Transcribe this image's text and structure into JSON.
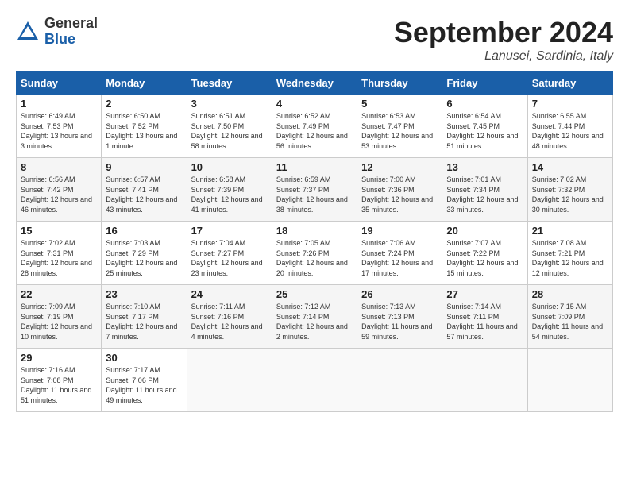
{
  "header": {
    "logo_general": "General",
    "logo_blue": "Blue",
    "month_title": "September 2024",
    "location": "Lanusei, Sardinia, Italy"
  },
  "weekdays": [
    "Sunday",
    "Monday",
    "Tuesday",
    "Wednesday",
    "Thursday",
    "Friday",
    "Saturday"
  ],
  "weeks": [
    [
      {
        "day": "1",
        "detail": "Sunrise: 6:49 AM\nSunset: 7:53 PM\nDaylight: 13 hours\nand 3 minutes."
      },
      {
        "day": "2",
        "detail": "Sunrise: 6:50 AM\nSunset: 7:52 PM\nDaylight: 13 hours\nand 1 minute."
      },
      {
        "day": "3",
        "detail": "Sunrise: 6:51 AM\nSunset: 7:50 PM\nDaylight: 12 hours\nand 58 minutes."
      },
      {
        "day": "4",
        "detail": "Sunrise: 6:52 AM\nSunset: 7:49 PM\nDaylight: 12 hours\nand 56 minutes."
      },
      {
        "day": "5",
        "detail": "Sunrise: 6:53 AM\nSunset: 7:47 PM\nDaylight: 12 hours\nand 53 minutes."
      },
      {
        "day": "6",
        "detail": "Sunrise: 6:54 AM\nSunset: 7:45 PM\nDaylight: 12 hours\nand 51 minutes."
      },
      {
        "day": "7",
        "detail": "Sunrise: 6:55 AM\nSunset: 7:44 PM\nDaylight: 12 hours\nand 48 minutes."
      }
    ],
    [
      {
        "day": "8",
        "detail": "Sunrise: 6:56 AM\nSunset: 7:42 PM\nDaylight: 12 hours\nand 46 minutes."
      },
      {
        "day": "9",
        "detail": "Sunrise: 6:57 AM\nSunset: 7:41 PM\nDaylight: 12 hours\nand 43 minutes."
      },
      {
        "day": "10",
        "detail": "Sunrise: 6:58 AM\nSunset: 7:39 PM\nDaylight: 12 hours\nand 41 minutes."
      },
      {
        "day": "11",
        "detail": "Sunrise: 6:59 AM\nSunset: 7:37 PM\nDaylight: 12 hours\nand 38 minutes."
      },
      {
        "day": "12",
        "detail": "Sunrise: 7:00 AM\nSunset: 7:36 PM\nDaylight: 12 hours\nand 35 minutes."
      },
      {
        "day": "13",
        "detail": "Sunrise: 7:01 AM\nSunset: 7:34 PM\nDaylight: 12 hours\nand 33 minutes."
      },
      {
        "day": "14",
        "detail": "Sunrise: 7:02 AM\nSunset: 7:32 PM\nDaylight: 12 hours\nand 30 minutes."
      }
    ],
    [
      {
        "day": "15",
        "detail": "Sunrise: 7:02 AM\nSunset: 7:31 PM\nDaylight: 12 hours\nand 28 minutes."
      },
      {
        "day": "16",
        "detail": "Sunrise: 7:03 AM\nSunset: 7:29 PM\nDaylight: 12 hours\nand 25 minutes."
      },
      {
        "day": "17",
        "detail": "Sunrise: 7:04 AM\nSunset: 7:27 PM\nDaylight: 12 hours\nand 23 minutes."
      },
      {
        "day": "18",
        "detail": "Sunrise: 7:05 AM\nSunset: 7:26 PM\nDaylight: 12 hours\nand 20 minutes."
      },
      {
        "day": "19",
        "detail": "Sunrise: 7:06 AM\nSunset: 7:24 PM\nDaylight: 12 hours\nand 17 minutes."
      },
      {
        "day": "20",
        "detail": "Sunrise: 7:07 AM\nSunset: 7:22 PM\nDaylight: 12 hours\nand 15 minutes."
      },
      {
        "day": "21",
        "detail": "Sunrise: 7:08 AM\nSunset: 7:21 PM\nDaylight: 12 hours\nand 12 minutes."
      }
    ],
    [
      {
        "day": "22",
        "detail": "Sunrise: 7:09 AM\nSunset: 7:19 PM\nDaylight: 12 hours\nand 10 minutes."
      },
      {
        "day": "23",
        "detail": "Sunrise: 7:10 AM\nSunset: 7:17 PM\nDaylight: 12 hours\nand 7 minutes."
      },
      {
        "day": "24",
        "detail": "Sunrise: 7:11 AM\nSunset: 7:16 PM\nDaylight: 12 hours\nand 4 minutes."
      },
      {
        "day": "25",
        "detail": "Sunrise: 7:12 AM\nSunset: 7:14 PM\nDaylight: 12 hours\nand 2 minutes."
      },
      {
        "day": "26",
        "detail": "Sunrise: 7:13 AM\nSunset: 7:13 PM\nDaylight: 11 hours\nand 59 minutes."
      },
      {
        "day": "27",
        "detail": "Sunrise: 7:14 AM\nSunset: 7:11 PM\nDaylight: 11 hours\nand 57 minutes."
      },
      {
        "day": "28",
        "detail": "Sunrise: 7:15 AM\nSunset: 7:09 PM\nDaylight: 11 hours\nand 54 minutes."
      }
    ],
    [
      {
        "day": "29",
        "detail": "Sunrise: 7:16 AM\nSunset: 7:08 PM\nDaylight: 11 hours\nand 51 minutes."
      },
      {
        "day": "30",
        "detail": "Sunrise: 7:17 AM\nSunset: 7:06 PM\nDaylight: 11 hours\nand 49 minutes."
      },
      {
        "day": "",
        "detail": ""
      },
      {
        "day": "",
        "detail": ""
      },
      {
        "day": "",
        "detail": ""
      },
      {
        "day": "",
        "detail": ""
      },
      {
        "day": "",
        "detail": ""
      }
    ]
  ]
}
